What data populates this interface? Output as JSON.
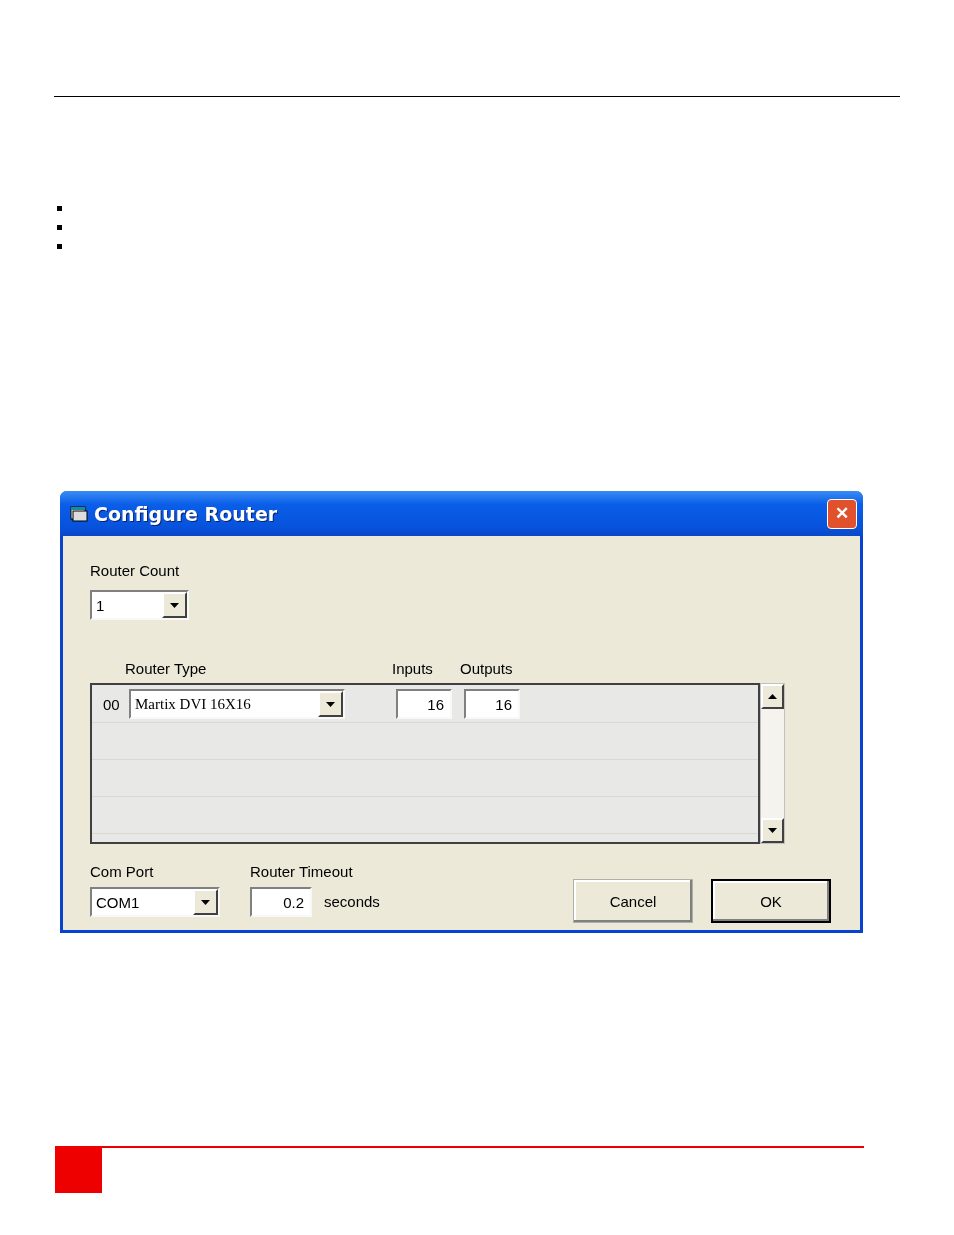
{
  "window": {
    "title": "Configure Router",
    "close": "✕"
  },
  "router_count": {
    "label": "Router Count",
    "value": "1"
  },
  "router_table": {
    "columns": [
      "Router Type",
      "Inputs",
      "Outputs"
    ],
    "rows": [
      {
        "index": "00",
        "type": "Martix DVI 16X16",
        "inputs": "16",
        "outputs": "16"
      }
    ]
  },
  "com_port": {
    "label": "Com Port",
    "value": "COM1"
  },
  "router_timeout": {
    "label": "Router Timeout",
    "value": "0.2",
    "unit": "seconds"
  },
  "buttons": [
    {
      "label": "Cancel",
      "default": false
    },
    {
      "label": "OK",
      "default": true
    }
  ]
}
